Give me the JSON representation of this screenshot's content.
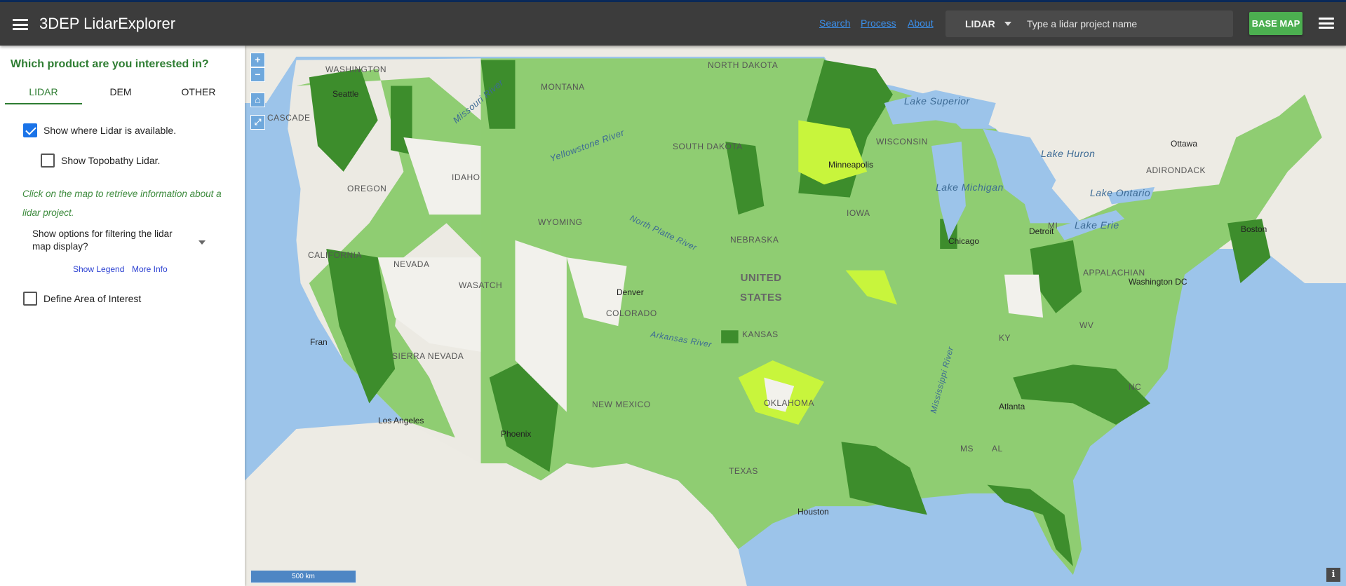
{
  "header": {
    "title": "3DEP LidarExplorer",
    "links": [
      "Search",
      "Process",
      "About"
    ],
    "search_type": "LIDAR",
    "search_placeholder": "Type a lidar project name",
    "basemap_label": "BASE MAP"
  },
  "sidebar": {
    "heading": "Which product are you interested in?",
    "tabs": [
      "LIDAR",
      "DEM",
      "OTHER"
    ],
    "active_tab": "LIDAR",
    "show_lidar": {
      "label": "Show where Lidar is available.",
      "checked": true
    },
    "show_topobathy": {
      "label": "Show Topobathy Lidar.",
      "checked": false
    },
    "hint": "Click on the map to retrieve information about a lidar project.",
    "filter_label": "Show options for filtering the lidar map display?",
    "show_legend": "Show Legend",
    "more_info": "More Info",
    "aoi": {
      "label": "Define Area of Interest",
      "checked": false
    }
  },
  "map": {
    "zoom_in": "+",
    "zoom_out": "−",
    "scale": "500 km",
    "info": "i",
    "colors": {
      "ocean": "#9cc4ea",
      "land": "#eeece6",
      "lidar": "#8fcd72",
      "lidar_dark": "#3d8d2c",
      "lidar_lime": "#c8f53c"
    },
    "labels": {
      "washington": "WASHINGTON",
      "montana": "MONTANA",
      "north_dakota": "NORTH DAKOTA",
      "south_dakota": "SOUTH DAKOTA",
      "oregon": "OREGON",
      "idaho": "IDAHO",
      "wyoming": "WYOMING",
      "nebraska": "NEBRASKA",
      "iowa": "IOWA",
      "nevada": "NEVADA",
      "california": "CALIFORNIA",
      "colorado": "COLORADO",
      "kansas": "KANSAS",
      "united_states": "UNITED STATES",
      "new_mexico": "NEW MEXICO",
      "texas": "TEXAS",
      "oklahoma": "OKLAHOMA",
      "wisconsin": "WISCONSIN",
      "sierra_nevada": "SIERRA NEVADA",
      "wasatch": "WASATCH",
      "cascade": "CASCADE",
      "adirondack": "ADIRONDACK",
      "appalachian": "APPALACHIAN",
      "ky": "KY",
      "mi": "MI",
      "ms": "MS",
      "al": "AL",
      "wv": "WV",
      "nc": "NC",
      "lake_superior": "Lake Superior",
      "lake_huron": "Lake Huron",
      "lake_michigan": "Lake Michigan",
      "lake_ontario": "Lake Ontario",
      "lake_erie": "Lake Erie",
      "missouri_river": "Missouri River",
      "yellowstone_river": "Yellowstone River",
      "north_platte": "North Platte River",
      "arkansas_river": "Arkansas River",
      "mississippi_river": "Mississippi River",
      "ottawa": "Ottawa",
      "boston": "Boston",
      "washington_dc": "Washington DC",
      "detroit": "Detroit",
      "chicago": "Chicago",
      "los_angeles": "Los Angeles",
      "phoenix": "Phoenix",
      "houston": "Houston",
      "atlanta": "Atlanta",
      "denver": "Denver",
      "minneapolis": "Minneapolis",
      "seattle": "Seattle",
      "fran": "Fran"
    }
  }
}
